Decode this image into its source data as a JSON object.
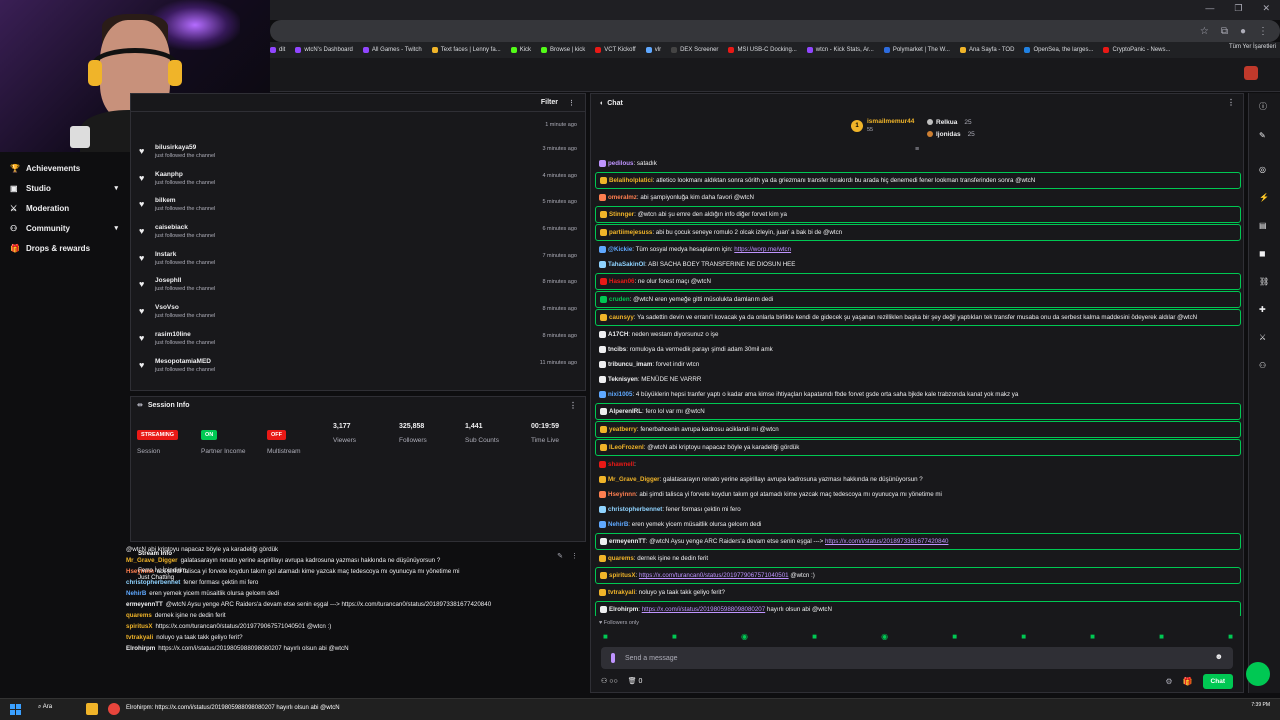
{
  "browser": {
    "bookmarks": [
      "dit",
      "wtcN's Dashboard",
      "All Games - Twitch",
      "Text faces | Lenny fa...",
      "Kick",
      "Browse | kick",
      "VCT Kickoff",
      "vlr",
      "DEX Screener",
      "MSI USB-C Docking...",
      "wtcn - Kick Stats, Ar...",
      "Polymarket | The W...",
      "Ana Sayfa - TOD",
      "OpenSea, the larges...",
      "CryptoPanic - News..."
    ],
    "bookmarks_end": "Tüm Yer İşaretleri"
  },
  "sidebar": {
    "items": [
      {
        "label": "Achievements",
        "icon": "trophy-icon",
        "chevron": false
      },
      {
        "label": "Studio",
        "icon": "video-icon",
        "chevron": true
      },
      {
        "label": "Moderation",
        "icon": "sword-icon",
        "chevron": false
      },
      {
        "label": "Community",
        "icon": "people-icon",
        "chevron": true
      },
      {
        "label": "Drops & rewards",
        "icon": "gift-icon",
        "chevron": false
      }
    ]
  },
  "activity": {
    "filter_label": "Filter",
    "first_time": "1 minute ago",
    "items": [
      {
        "user": "bilusirkaya59",
        "action": "just followed the channel",
        "ago": "3 minutes ago"
      },
      {
        "user": "Kaanphp",
        "action": "just followed the channel",
        "ago": "4 minutes ago"
      },
      {
        "user": "bilkem",
        "action": "just followed the channel",
        "ago": "5 minutes ago"
      },
      {
        "user": "caisebiack",
        "action": "just followed the channel",
        "ago": "6 minutes ago"
      },
      {
        "user": "Instark",
        "action": "just followed the channel",
        "ago": "7 minutes ago"
      },
      {
        "user": "Josephll",
        "action": "just followed the channel",
        "ago": "8 minutes ago"
      },
      {
        "user": "VsoVso",
        "action": "just followed the channel",
        "ago": "8 minutes ago"
      },
      {
        "user": "rasim10line",
        "action": "just followed the channel",
        "ago": "8 minutes ago"
      },
      {
        "user": "MesopotamiaMED",
        "action": "just followed the channel",
        "ago": "11 minutes ago"
      }
    ]
  },
  "session": {
    "title": "Session Info",
    "stats": [
      {
        "badge": "STREAMING",
        "badge_color": "#e91916",
        "label": "Session"
      },
      {
        "badge": "ON",
        "badge_color": "#00c853",
        "label": "Partner Income"
      },
      {
        "badge": "OFF",
        "badge_color": "#e91916",
        "label": "Multistream"
      },
      {
        "value": "3,177",
        "label": "Viewers"
      },
      {
        "value": "325,858",
        "label": "Followers"
      },
      {
        "value": "1,441",
        "label": "Sub Counts"
      },
      {
        "value": "00:19:59",
        "label": "Time Live"
      }
    ]
  },
  "mini_chat": {
    "overlay_title": "Stream Info",
    "overlay_sub": "Ferro İv: İpindirim",
    "overlay_sub2": "Just Chatting",
    "lines": [
      {
        "user": "",
        "text": "@wtcN abi kriptoyu napacaz böyle ya karadeliği gördük",
        "color": "#efeff1"
      },
      {
        "user": "",
        "text": "",
        "color": "#efeff1"
      },
      {
        "user": "Mr_Grave_Digger",
        "text": "galatasarayın renato yerine aspirillayı avrupa kadrosuna yazması hakkında ne düşünüyorsun ?",
        "color": "#f0b429"
      },
      {
        "user": "Hseyinnn",
        "text": "abi şimdi talisca yi forvete koydun takım gol atamadı kime yazcak maç tedescoya mı oyunucya mı yönetime mi",
        "color": "#ff7f50"
      },
      {
        "user": "christopherbennet",
        "text": "fener forması çektin mi fero",
        "color": "#8fd3ff"
      },
      {
        "user": "NehirB",
        "text": "eren yemek yicem müsaitlik olursa gelcem dedi",
        "color": "#5fa8ff"
      },
      {
        "user": "ermeyennTT",
        "text": "@wtcN Aysu yenge ARC Raiders'a devam etse senin eşgal ---> https://x.com/turancan0/status/2018973381677420840",
        "color": "#efeff1"
      },
      {
        "user": "quarems",
        "text": "dernek işine ne dedin ferit",
        "color": "#f0b429"
      },
      {
        "user": "spiritusX",
        "text": "https://x.com/turancan0/status/2019779067571040501 @wtcn :)",
        "color": "#f0b429"
      },
      {
        "user": "tvtrakyali",
        "text": "noluyo ya taak takk geliyo ferit?",
        "color": "#f0b429"
      },
      {
        "user": "Elrohirpm",
        "text": "https://x.com/i/status/2019805988098080207 hayırlı olsun abi @wtcN",
        "color": "#efeff1"
      }
    ]
  },
  "chat": {
    "title": "Chat",
    "leaderboard": {
      "top_name": "ismailmemur44",
      "top_pts": "55",
      "others": [
        {
          "name": "Relkua",
          "pts": "25"
        },
        {
          "name": "ljonidas",
          "pts": "25"
        }
      ]
    },
    "messages": [
      {
        "user": "pedilous",
        "text": "satadık",
        "ucolor": "#bf94ff",
        "hl": false,
        "link": ""
      },
      {
        "user": "Belaliholplatici",
        "text": "atletico lookmanı aldıktan sonra sörith ya da griezmanı transfer bırakırdı bu arada hiç denemedi fener lookman transferinden sonra @wtcN",
        "ucolor": "#f0b429",
        "hl": true,
        "link": ""
      },
      {
        "user": "omeralmz",
        "text": "abi şampiyonluğa kim daha favori @wtcN",
        "ucolor": "#ff7f50",
        "hl": false,
        "link": ""
      },
      {
        "user": "Stinnger",
        "text": "@wtcn abi şu emre den aldığın info diğer forvet kim ya",
        "ucolor": "#f0b429",
        "hl": true,
        "link": ""
      },
      {
        "user": "partiimejesuss",
        "text": "abi bu çocuk seneye romulo 2 olcak izleyin, juan' a bak bi de @wtcn",
        "ucolor": "#f0b429",
        "hl": true,
        "link": ""
      },
      {
        "user": "@Kickie",
        "text": "Tüm sosyal medya hesaplarım için: ",
        "ucolor": "#5fa8ff",
        "hl": false,
        "link": "https://worp.me/wtcn"
      },
      {
        "user": "TahaSakinOl",
        "text": "ABI SACHA BOEY TRANSFERINE NE DIOSUN HEE",
        "ucolor": "#8fd3ff",
        "hl": false,
        "link": ""
      },
      {
        "user": "Hasan06",
        "text": "ne olur forest maçı @wtcN",
        "ucolor": "#e91916",
        "hl": true,
        "link": ""
      },
      {
        "user": "cruden",
        "text": "@wtcN eren yemeğe gitti müsolukta damlarım dedi",
        "ucolor": "#00c853",
        "hl": true,
        "link": ""
      },
      {
        "user": "caunsyy",
        "text": "Ya sadettin devin ve erranı'l kovacak ya da onlarla birlikte kendi de gidecek şu yaşanan rezilliklen başka bir şey değil yaptıkları tek transfer musaba onu da serbest kalma maddesini ödeyerek aldılar @wtcN",
        "ucolor": "#f0b429",
        "hl": true,
        "link": ""
      },
      {
        "user": "A17CH",
        "text": "neden westam diyorsunuz o işe",
        "ucolor": "#efeff1",
        "hl": false,
        "link": ""
      },
      {
        "user": "tncibs",
        "text": "romuloya da vermedik parayı şimdi adam 30mil amk",
        "ucolor": "#efeff1",
        "hl": false,
        "link": ""
      },
      {
        "user": "tribuncu_imam",
        "text": "forvet indir wtcn",
        "ucolor": "#efeff1",
        "hl": false,
        "link": ""
      },
      {
        "user": "Teknisyen",
        "text": "MENÜDE NE VARRR",
        "ucolor": "#efeff1",
        "hl": false,
        "link": ""
      },
      {
        "user": "nixi1005",
        "text": "4 büyüklerin hepsi tranfer yaptı o kadar ama kimse ihtiyaçları kapatamdı fbde forvet gsde orta saha bjkde kale trabzonda kanat yok makz ya",
        "ucolor": "#5fa8ff",
        "hl": false,
        "link": ""
      },
      {
        "user": "AlperenIRL",
        "text": "fero lol var mı @wtcN",
        "ucolor": "#efeff1",
        "hl": true,
        "link": ""
      },
      {
        "user": "yeatberry",
        "text": "fenerbahcenin avrupa kadrosu aciklandi mi @wtcn",
        "ucolor": "#f0b429",
        "hl": true,
        "link": ""
      },
      {
        "user": "lLeoFrozenl",
        "text": "@wtcN abi kriptoyu napacaz böyle ya karadeliği gördük",
        "ucolor": "#f0b429",
        "hl": true,
        "link": ""
      },
      {
        "user": "shawnell",
        "text": "",
        "ucolor": "#e91916",
        "hl": false,
        "link": ""
      },
      {
        "user": "Mr_Grave_Digger",
        "text": "galatasarayın renato yerine aspirillayı avrupa kadrosuna yazması hakkında ne düşünüyorsun ?",
        "ucolor": "#f0b429",
        "hl": false,
        "link": ""
      },
      {
        "user": "Hseyinnn",
        "text": "abi şimdi talisca yi forvete koydun takım gol atamadı kime yazcak maç tedescoya mı oyunucya mı yönetime mi",
        "ucolor": "#ff7f50",
        "hl": false,
        "link": ""
      },
      {
        "user": "christopherbennet",
        "text": "fener forması çektin mi fero",
        "ucolor": "#8fd3ff",
        "hl": false,
        "link": ""
      },
      {
        "user": "NehirB",
        "text": "eren yemek yicem müsaitlik olursa gelcem dedi",
        "ucolor": "#5fa8ff",
        "hl": false,
        "link": ""
      },
      {
        "user": "ermeyennTT",
        "text": "@wtcN Aysu yenge ARC Raiders'a devam etse senin eşgal ---> ",
        "ucolor": "#efeff1",
        "hl": true,
        "link": "https://x.com/i/status/2018973381677420840"
      },
      {
        "user": "quarems",
        "text": "dernek işine ne dedin ferit",
        "ucolor": "#f0b429",
        "hl": false,
        "link": ""
      },
      {
        "user": "spiritusX",
        "text": " @wtcn :)",
        "ucolor": "#f0b429",
        "hl": true,
        "link": "https://x.com/turancan0/status/2019779067571040501"
      },
      {
        "user": "tvtrakyali",
        "text": "noluyo ya taak takk geliyo ferit?",
        "ucolor": "#f0b429",
        "hl": false,
        "link": ""
      },
      {
        "user": "Elrohirpm",
        "text": " hayırlı olsun abi @wtcN",
        "ucolor": "#efeff1",
        "hl": true,
        "link": "https://x.com/i/status/2019805988098080207"
      }
    ],
    "followers_only": "Followers only",
    "input_placeholder": "Send a message",
    "footer_count": "0",
    "chat_button": "Chat"
  },
  "taskbar": {
    "search_label": "Ara",
    "ticker": "Elrohirpm: https://x.com/i/status/2019805988098080207 hayırlı olsun abi @wtcN",
    "time": "7:39 PM"
  }
}
